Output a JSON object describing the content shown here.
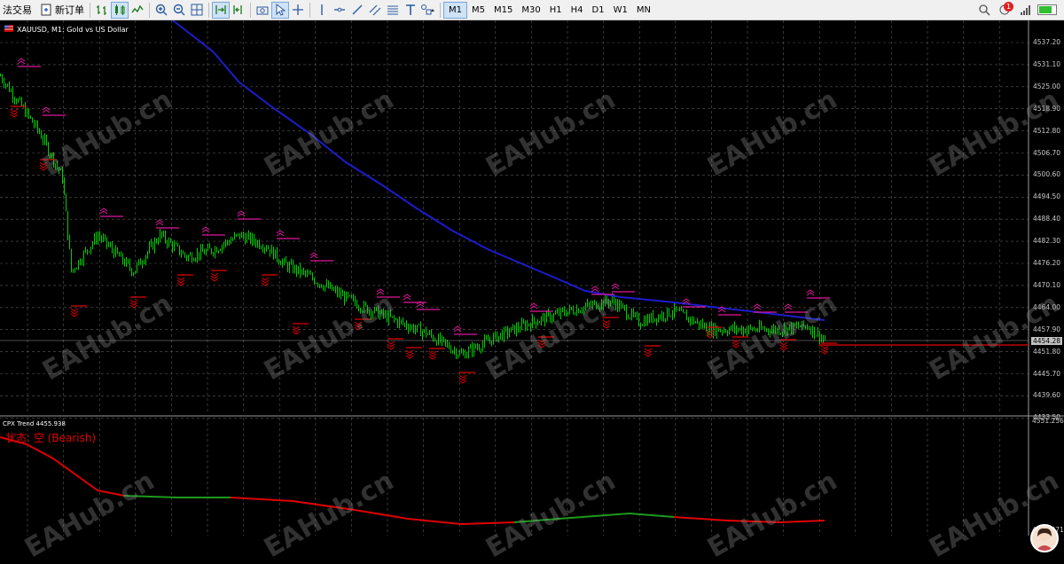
{
  "toolbar": {
    "algo_label": "法交易",
    "new_order_label": "新订单",
    "timeframes": [
      "M1",
      "M5",
      "M15",
      "M30",
      "H1",
      "H4",
      "D1",
      "W1",
      "MN"
    ],
    "active_timeframe": "M1",
    "notification_count": "1"
  },
  "main_chart": {
    "title": "XAUUSD, M1:  Gold vs US Dollar",
    "current_price": "4454.28",
    "price_ticks": [
      "4537.20",
      "4531.10",
      "4525.00",
      "4518.90",
      "4512.80",
      "4506.70",
      "4500.60",
      "4494.50",
      "4488.40",
      "4482.30",
      "4476.20",
      "4470.10",
      "4464.00",
      "4457.90",
      "4451.80",
      "4445.70",
      "4439.60",
      "4433.50"
    ]
  },
  "subwindow": {
    "title": "CPX Trend 4455.938",
    "status": "状态: 空 (Bearish)",
    "ticks": [
      "4551.256",
      "4445.271"
    ]
  },
  "watermark": "EAHub.cn",
  "colors": {
    "bull": "#00d000",
    "ma": "#1c1ccc",
    "signal": "#e0179c",
    "bear": "#e00000",
    "grid": "#5a5a5a"
  }
}
